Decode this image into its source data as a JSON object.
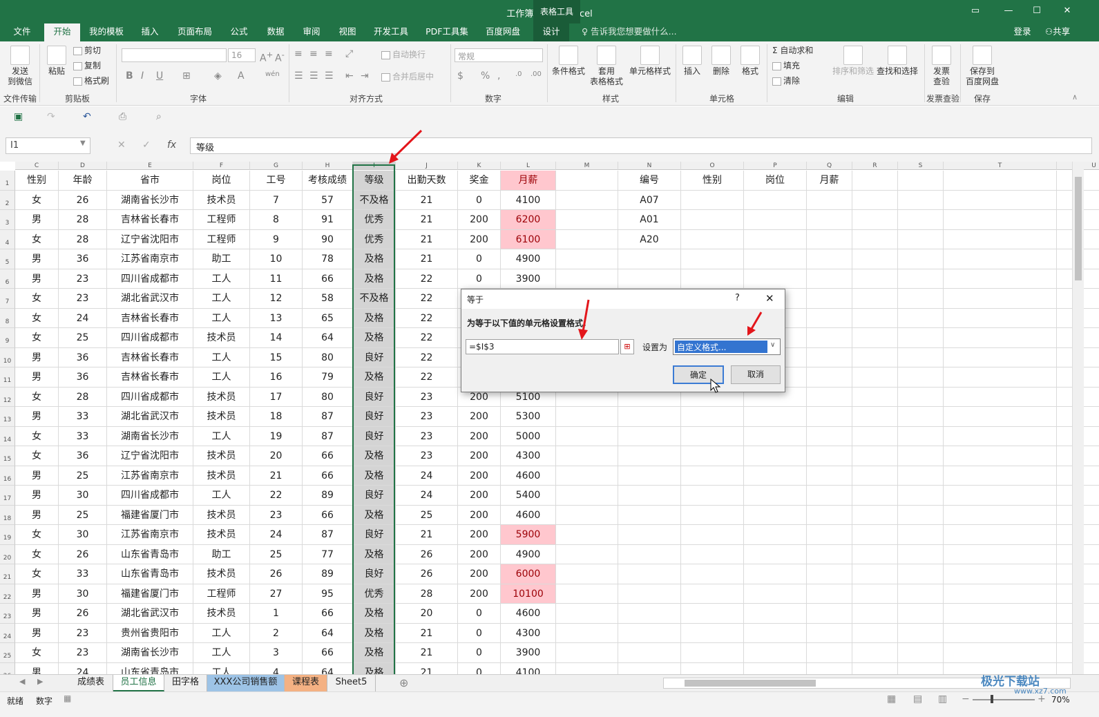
{
  "app": {
    "title": "工作簿3.xlsx - Excel",
    "context_tab": "表格工具"
  },
  "tabs": [
    "文件",
    "开始",
    "我的模板",
    "插入",
    "页面布局",
    "公式",
    "数据",
    "审阅",
    "视图",
    "开发工具",
    "PDF工具集",
    "百度网盘",
    "设计"
  ],
  "tell_me": "告诉我您想要做什么...",
  "login": "登录",
  "share": "共享",
  "ribbon": {
    "send_wechat": "发送\n到微信",
    "paste": "粘贴",
    "cut": "剪切",
    "copy": "复制",
    "format_painter": "格式刷",
    "font_size": "16",
    "wrap": "自动换行",
    "merge": "合并后居中",
    "number_format": "常规",
    "cond_format": "条件格式",
    "table_format": "套用\n表格格式",
    "cell_style": "单元格样式",
    "insert": "插入",
    "delete": "删除",
    "format": "格式",
    "autosum": "自动求和",
    "fill": "填充",
    "clear": "清除",
    "sort_filter": "排序和筛选",
    "find_select": "查找和选择",
    "invoice": "发票\n查验",
    "save_baidu": "保存到\n百度网盘",
    "groups": [
      "文件传输",
      "剪贴板",
      "字体",
      "对齐方式",
      "数字",
      "样式",
      "单元格",
      "编辑",
      "发票查验",
      "保存"
    ]
  },
  "formula_bar": {
    "name_box": "I1",
    "fx": "fx",
    "content": "等级"
  },
  "columns": [
    "C",
    "D",
    "E",
    "F",
    "G",
    "H",
    "I",
    "J",
    "K",
    "L",
    "M",
    "N",
    "O",
    "P",
    "Q",
    "R",
    "S",
    "T",
    "U"
  ],
  "header_row": [
    "性别",
    "年龄",
    "省市",
    "岗位",
    "工号",
    "考核成绩",
    "等级",
    "出勤天数",
    "奖金",
    "月薪",
    "",
    "编号",
    "性别",
    "岗位",
    "月薪"
  ],
  "rows": [
    [
      "女",
      "26",
      "湖南省长沙市",
      "技术员",
      "7",
      "57",
      "不及格",
      "21",
      "0",
      "4100",
      "",
      "A07"
    ],
    [
      "男",
      "28",
      "吉林省长春市",
      "工程师",
      "8",
      "91",
      "优秀",
      "21",
      "200",
      "6200",
      "",
      "A01"
    ],
    [
      "女",
      "28",
      "辽宁省沈阳市",
      "工程师",
      "9",
      "90",
      "优秀",
      "21",
      "200",
      "6100",
      "",
      "A20"
    ],
    [
      "男",
      "36",
      "江苏省南京市",
      "助工",
      "10",
      "78",
      "及格",
      "21",
      "0",
      "4900",
      "",
      ""
    ],
    [
      "男",
      "23",
      "四川省成都市",
      "工人",
      "11",
      "66",
      "及格",
      "22",
      "0",
      "3900",
      "",
      ""
    ],
    [
      "女",
      "23",
      "湖北省武汉市",
      "工人",
      "12",
      "58",
      "不及格",
      "22",
      "",
      "",
      "",
      ""
    ],
    [
      "女",
      "24",
      "吉林省长春市",
      "工人",
      "13",
      "65",
      "及格",
      "22",
      "",
      "",
      "",
      ""
    ],
    [
      "女",
      "25",
      "四川省成都市",
      "技术员",
      "14",
      "64",
      "及格",
      "22",
      "",
      "",
      "",
      ""
    ],
    [
      "男",
      "36",
      "吉林省长春市",
      "工人",
      "15",
      "80",
      "良好",
      "22",
      "",
      "",
      "",
      ""
    ],
    [
      "男",
      "36",
      "吉林省长春市",
      "工人",
      "16",
      "79",
      "及格",
      "22",
      "",
      "",
      "",
      ""
    ],
    [
      "女",
      "28",
      "四川省成都市",
      "技术员",
      "17",
      "80",
      "良好",
      "23",
      "200",
      "5100",
      "",
      ""
    ],
    [
      "男",
      "33",
      "湖北省武汉市",
      "技术员",
      "18",
      "87",
      "良好",
      "23",
      "200",
      "5300",
      "",
      ""
    ],
    [
      "女",
      "33",
      "湖南省长沙市",
      "工人",
      "19",
      "87",
      "良好",
      "23",
      "200",
      "5000",
      "",
      ""
    ],
    [
      "女",
      "36",
      "辽宁省沈阳市",
      "技术员",
      "20",
      "66",
      "及格",
      "23",
      "200",
      "4300",
      "",
      ""
    ],
    [
      "男",
      "25",
      "江苏省南京市",
      "技术员",
      "21",
      "66",
      "及格",
      "24",
      "200",
      "4600",
      "",
      ""
    ],
    [
      "男",
      "30",
      "四川省成都市",
      "工人",
      "22",
      "89",
      "良好",
      "24",
      "200",
      "5400",
      "",
      ""
    ],
    [
      "男",
      "25",
      "福建省厦门市",
      "技术员",
      "23",
      "66",
      "及格",
      "25",
      "200",
      "4600",
      "",
      ""
    ],
    [
      "女",
      "30",
      "江苏省南京市",
      "技术员",
      "24",
      "87",
      "良好",
      "21",
      "200",
      "5900",
      "",
      ""
    ],
    [
      "女",
      "26",
      "山东省青岛市",
      "助工",
      "25",
      "77",
      "及格",
      "26",
      "200",
      "4900",
      "",
      ""
    ],
    [
      "女",
      "33",
      "山东省青岛市",
      "技术员",
      "26",
      "89",
      "良好",
      "26",
      "200",
      "6000",
      "",
      ""
    ],
    [
      "男",
      "30",
      "福建省厦门市",
      "工程师",
      "27",
      "95",
      "优秀",
      "28",
      "200",
      "10100",
      "",
      ""
    ],
    [
      "男",
      "26",
      "湖北省武汉市",
      "技术员",
      "1",
      "66",
      "及格",
      "20",
      "0",
      "4600",
      "",
      ""
    ],
    [
      "男",
      "23",
      "贵州省贵阳市",
      "工人",
      "2",
      "64",
      "及格",
      "21",
      "0",
      "4300",
      "",
      ""
    ],
    [
      "女",
      "23",
      "湖南省长沙市",
      "工人",
      "3",
      "66",
      "及格",
      "21",
      "0",
      "3900",
      "",
      ""
    ],
    [
      "男",
      "24",
      "山东省青岛市",
      "工人",
      "4",
      "64",
      "及格",
      "21",
      "0",
      "4100",
      "",
      ""
    ]
  ],
  "highlight": {
    "pink_cells": [
      [
        2,
        9
      ],
      [
        3,
        9
      ],
      [
        18,
        9
      ],
      [
        20,
        9
      ],
      [
        21,
        9
      ]
    ],
    "pink_header_col": 9,
    "pink_color": "#ffc7ce",
    "selected_color": "#d4d4d4",
    "brand_green": "#217346"
  },
  "sheets": [
    "成绩表",
    "员工信息",
    "田字格",
    "XXX公司销售额",
    "课程表",
    "Sheet5"
  ],
  "active_sheet": "员工信息",
  "status": {
    "ready": "就绪",
    "mode": "数字",
    "zoom": "70%"
  },
  "watermark": "极光下载站",
  "watermark_url": "www.xz7.com",
  "dialog": {
    "title": "等于",
    "help": "?",
    "close": "✕",
    "prompt": "为等于以下值的单元格设置格式:",
    "value": "=$I$3",
    "set_as_label": "设置为",
    "set_as_value": "自定义格式...",
    "ok": "确定",
    "cancel": "取消"
  }
}
